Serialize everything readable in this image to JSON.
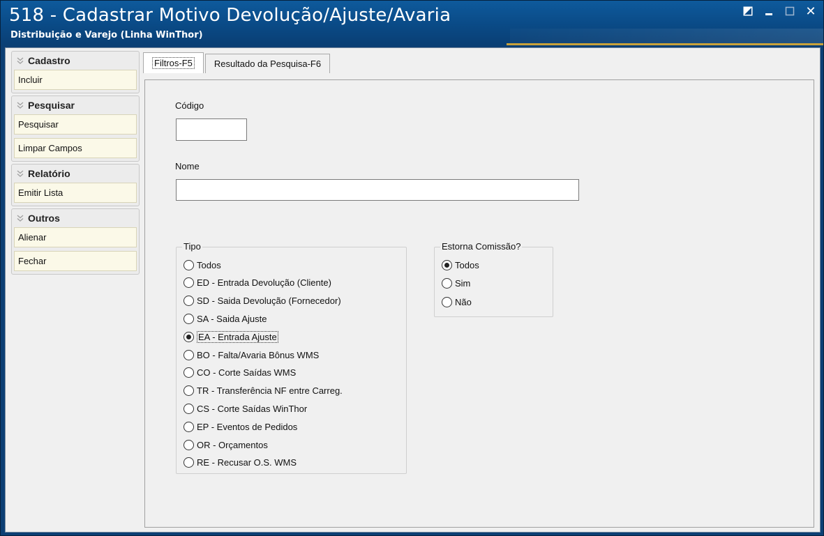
{
  "window": {
    "title": "518 - Cadastrar Motivo Devolução/Ajuste/Avaria",
    "subtitle": "Distribuição e Varejo (Linha WinThor)",
    "buttons": [
      "edit-icon",
      "minimize-icon",
      "maximize-icon",
      "close-icon"
    ],
    "close_glyph": "✕"
  },
  "sidebar": {
    "groups": [
      {
        "title": "Cadastro",
        "items": [
          "Incluir"
        ]
      },
      {
        "title": "Pesquisar",
        "items": [
          "Pesquisar",
          "Limpar Campos"
        ]
      },
      {
        "title": "Relatório",
        "items": [
          "Emitir Lista"
        ]
      },
      {
        "title": "Outros",
        "items": [
          "Alienar",
          "Fechar"
        ]
      }
    ]
  },
  "tabs": [
    {
      "label": "Filtros-F5",
      "active": true
    },
    {
      "label": "Resultado da Pesquisa-F6",
      "active": false
    }
  ],
  "form": {
    "codigo_label": "Código",
    "codigo_value": "",
    "nome_label": "Nome",
    "nome_value": "",
    "tipo": {
      "legend": "Tipo",
      "selected": "EA - Entrada Ajuste",
      "options": [
        "Todos",
        "ED - Entrada Devolução (Cliente)",
        "SD - Saida Devolução (Fornecedor)",
        "SA - Saida Ajuste",
        "EA - Entrada Ajuste",
        "BO - Falta/Avaria Bônus WMS",
        "CO - Corte Saídas WMS",
        "TR - Transferência NF entre Carreg.",
        "CS - Corte Saídas WinThor",
        "EP - Eventos de Pedidos",
        "OR - Orçamentos",
        "RE - Recusar O.S. WMS"
      ]
    },
    "estorna": {
      "legend": "Estorna Comissão?",
      "selected": "Todos",
      "options": [
        "Todos",
        "Sim",
        "Não"
      ]
    }
  },
  "colors": {
    "titlebar": "#0e5a9c",
    "accent_line": "#c9a23a",
    "sidebar_item_bg": "#fbf9e8"
  }
}
